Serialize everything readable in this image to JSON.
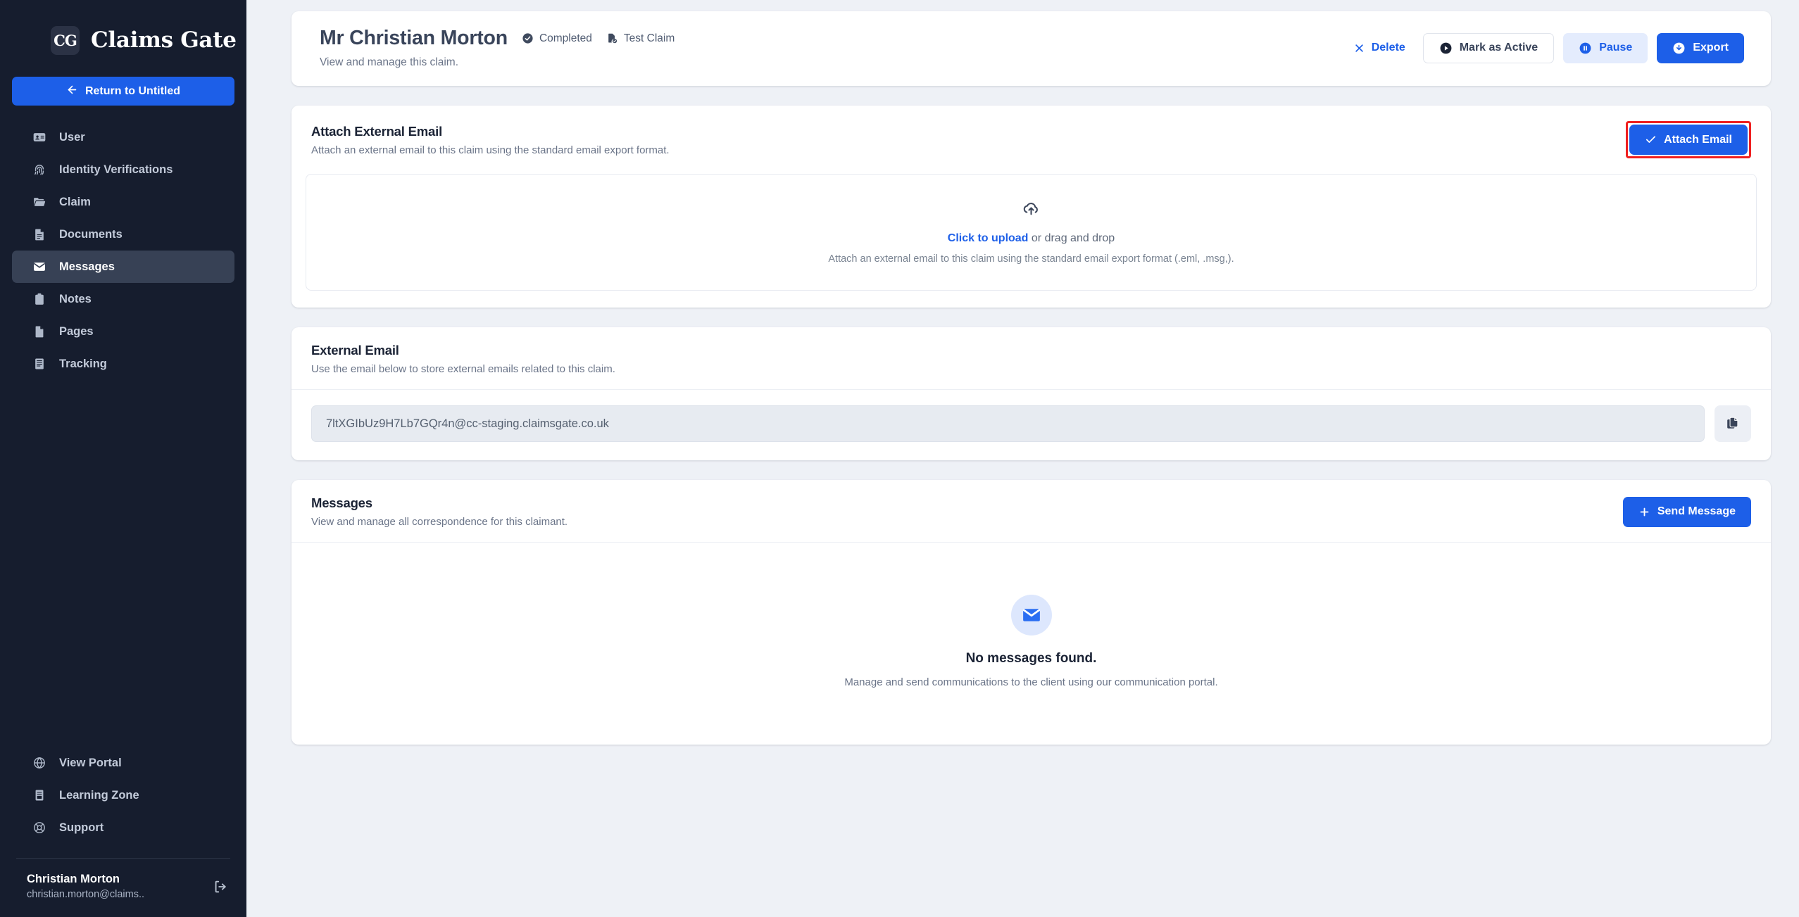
{
  "brand": {
    "logo_text": "CG",
    "name": "Claims Gate",
    "logo_icon": "claims-gate-logo-icon"
  },
  "sidebar": {
    "return_button": {
      "label": "Return to Untitled",
      "icon": "arrow-left-icon"
    },
    "items": [
      {
        "label": "User",
        "icon": "id-card-icon",
        "active": false
      },
      {
        "label": "Identity Verifications",
        "icon": "fingerprint-icon",
        "active": false
      },
      {
        "label": "Claim",
        "icon": "folder-icon",
        "active": false
      },
      {
        "label": "Documents",
        "icon": "document-icon",
        "active": false
      },
      {
        "label": "Messages",
        "icon": "envelope-icon",
        "active": true
      },
      {
        "label": "Notes",
        "icon": "clipboard-icon",
        "active": false
      },
      {
        "label": "Pages",
        "icon": "page-icon",
        "active": false
      },
      {
        "label": "Tracking",
        "icon": "list-icon",
        "active": false
      }
    ],
    "bottom_items": [
      {
        "label": "View Portal",
        "icon": "globe-icon"
      },
      {
        "label": "Learning Zone",
        "icon": "book-icon"
      },
      {
        "label": "Support",
        "icon": "lifebuoy-icon"
      }
    ],
    "account": {
      "name": "Christian Morton",
      "email": "christian.morton@claims..",
      "logout_icon": "logout-icon"
    }
  },
  "header": {
    "title": "Mr Christian Morton",
    "subtitle": "View and manage this claim.",
    "status_badge": {
      "label": "Completed",
      "icon": "check-circle-icon"
    },
    "type_badge": {
      "label": "Test Claim",
      "icon": "file-check-icon"
    },
    "actions": {
      "delete": {
        "label": "Delete",
        "icon": "x-icon"
      },
      "mark_active": {
        "label": "Mark as Active",
        "icon": "play-circle-icon"
      },
      "pause": {
        "label": "Pause",
        "icon": "pause-circle-icon"
      },
      "export": {
        "label": "Export",
        "icon": "download-circle-icon"
      }
    }
  },
  "attach_card": {
    "title": "Attach External Email",
    "subtitle": "Attach an external email to this claim using the standard email export format.",
    "button": {
      "label": "Attach Email",
      "icon": "check-icon",
      "highlighted": true
    },
    "dropzone": {
      "icon": "cloud-upload-icon",
      "link_text": "Click to upload",
      "rest_text": " or drag and drop",
      "hint": "Attach an external email to this claim using the standard email export format (.eml, .msg,)."
    }
  },
  "external_email_card": {
    "title": "External Email",
    "subtitle": "Use the email below to store external emails related to this claim.",
    "email": "7ltXGIbUz9H7Lb7GQr4n@cc-staging.claimsgate.co.uk",
    "copy_button_icon": "copy-icon"
  },
  "messages_card": {
    "title": "Messages",
    "subtitle": "View and manage all correspondence for this claimant.",
    "send_button": {
      "label": "Send Message",
      "icon": "plus-icon"
    },
    "empty_state": {
      "icon": "envelope-icon",
      "title": "No messages found.",
      "subtitle": "Manage and send communications to the client using our communication portal."
    }
  },
  "colors": {
    "accent": "#1d5fe8",
    "sidebar_bg": "#161d2e",
    "page_bg": "#eef1f6",
    "highlight": "#ef2020"
  }
}
